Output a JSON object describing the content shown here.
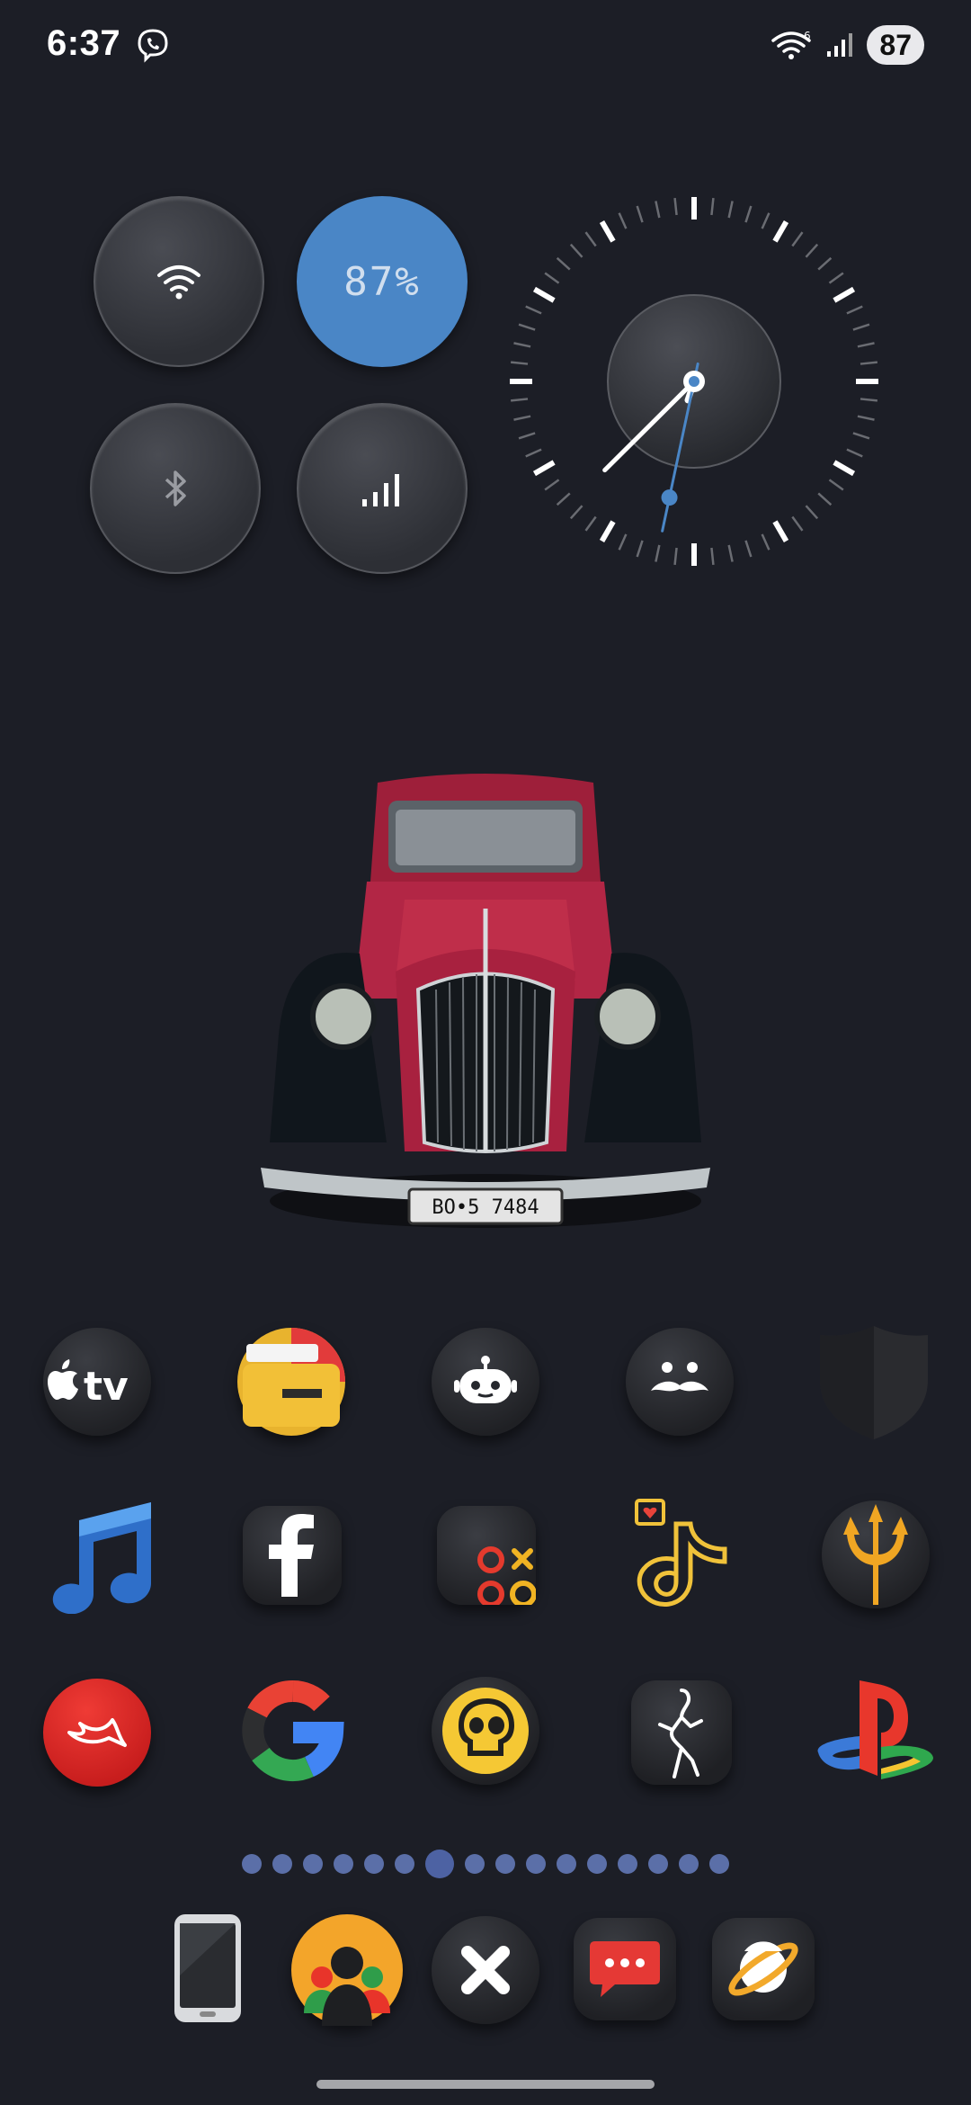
{
  "status": {
    "time": "6:37",
    "battery": "87",
    "wifi_label": "6"
  },
  "widgets": {
    "toggles": [
      {
        "name": "wifi",
        "icon": "wifi-icon",
        "active": false
      },
      {
        "name": "battery",
        "text": "87%",
        "active": true
      },
      {
        "name": "bluetooth",
        "icon": "bluetooth-icon",
        "active": false
      },
      {
        "name": "signal",
        "icon": "signal-icon",
        "active": false
      }
    ],
    "clock": {
      "hour": 6,
      "minute": 37,
      "second": 32
    }
  },
  "wallpaper": {
    "license_plate": "BO•5 7484",
    "body_color": "#a8213f"
  },
  "apps": [
    {
      "label": "Apple TV",
      "icon": "apple-tv-icon"
    },
    {
      "label": "Files",
      "icon": "file-manager-icon"
    },
    {
      "label": "Chatbot",
      "icon": "robot-icon"
    },
    {
      "label": "Moustache",
      "icon": "moustache-face-icon"
    },
    {
      "label": "Shield",
      "icon": "shield-icon"
    },
    {
      "label": "Music",
      "icon": "music-note-icon"
    },
    {
      "label": "Facebook",
      "icon": "facebook-icon"
    },
    {
      "label": "Tic Tac Toe",
      "icon": "tic-tac-toe-icon"
    },
    {
      "label": "TikTok",
      "icon": "tiktok-icon"
    },
    {
      "label": "Trident",
      "icon": "trident-icon"
    },
    {
      "label": "Swiftly",
      "icon": "swift-bird-icon"
    },
    {
      "label": "Google",
      "icon": "google-icon"
    },
    {
      "label": "Brawl Stars",
      "icon": "skull-icon"
    },
    {
      "label": "Dance",
      "icon": "dancer-icon"
    },
    {
      "label": "PlayStation",
      "icon": "playstation-icon"
    }
  ],
  "pages": {
    "count": 16,
    "current": 7
  },
  "dock": [
    {
      "label": "Phone",
      "icon": "phone-device-icon"
    },
    {
      "label": "Contacts",
      "icon": "contacts-icon"
    },
    {
      "label": "Close",
      "icon": "close-x-icon"
    },
    {
      "label": "Messages",
      "icon": "message-bubble-icon"
    },
    {
      "label": "Internet",
      "icon": "planet-icon"
    }
  ],
  "colors": {
    "background": "#1c1e26",
    "accent_blue": "#4a86c6",
    "page_dot": "#5b6fa8"
  }
}
